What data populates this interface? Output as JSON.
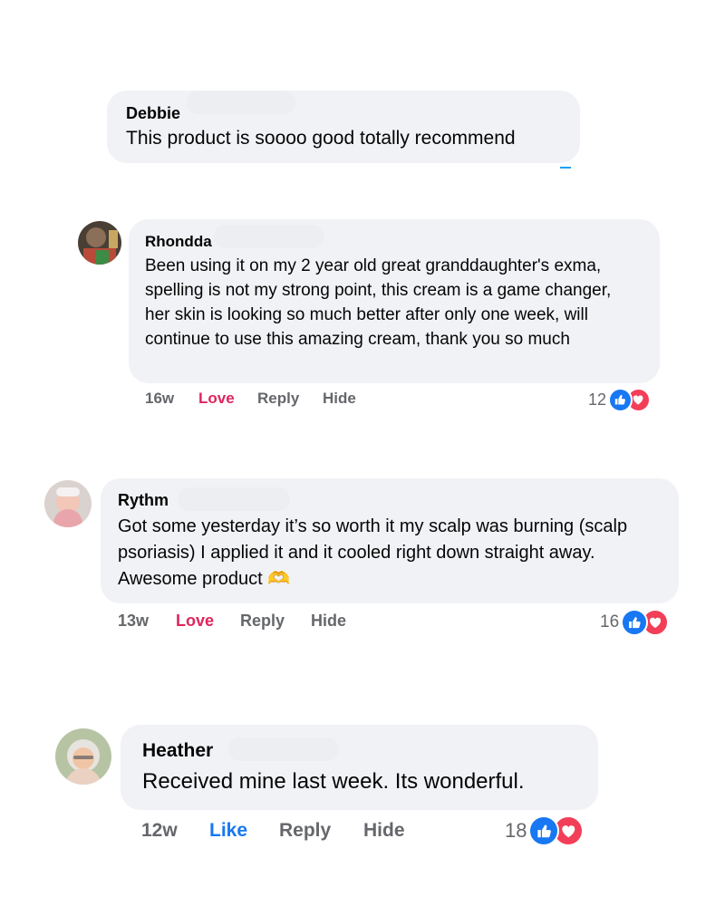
{
  "comments": [
    {
      "name": "Debbie",
      "text": "This product is soooo good totally recommend"
    },
    {
      "name": "Rhondda",
      "text": "Been using it on my 2 year old great granddaughter's exma, spelling is not my strong point, this cream is a game changer, her skin is looking so much better after only one week, will continue to use this amazing cream, thank you so much",
      "time": "16w",
      "reaction_action": "Love",
      "reply": "Reply",
      "hide": "Hide",
      "reaction_count": "12"
    },
    {
      "name": "Rythm",
      "text": "Got some yesterday it’s so worth it my scalp was burning (scalp psoriasis) I applied it and it cooled right down straight away. Awesome product 🫶",
      "time": "13w",
      "reaction_action": "Love",
      "reply": "Reply",
      "hide": "Hide",
      "reaction_count": "16"
    },
    {
      "name": "Heather",
      "text": "Received mine last week. Its wonderful.",
      "time": "12w",
      "reaction_action": "Like",
      "reply": "Reply",
      "hide": "Hide",
      "reaction_count": "18"
    }
  ],
  "colors": {
    "bubble": "#f0f2f5",
    "love": "#e0245e",
    "like": "#1877f2",
    "meta": "#65676b"
  },
  "icons": [
    "like-icon",
    "love-icon",
    "avatar"
  ]
}
